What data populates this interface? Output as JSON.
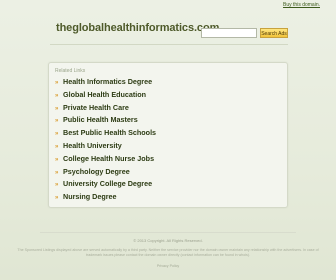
{
  "header": {
    "buy_link": "Buy this domain.",
    "domain": "theglobalhealthinformatics.com",
    "search_placeholder": "",
    "search_button": "Search Ads"
  },
  "panel": {
    "label": "Related Links",
    "links": [
      "Health Informatics Degree",
      "Global Health Education",
      "Private Health Care",
      "Public Health Masters",
      "Best Public Health Schools",
      "Health University",
      "College Health Nurse Jobs",
      "Psychology Degree",
      "University College Degree",
      "Nursing Degree"
    ]
  },
  "footer": {
    "copyright": "© 2013 Copyright. All Rights Reserved.",
    "disclaimer": "The Sponsored Listings displayed above are served automatically by a third party. Neither the service provider nor the domain owner maintain any relationship with the advertisers. In case of trademark issues please contact the domain owner directly (contact information can be found in whois).",
    "privacy": "Privacy Policy"
  },
  "colors": {
    "background": "#e3e9d7",
    "link_text": "#2d3c14",
    "arrow": "#d99a2a",
    "search_button": "#f2c43a"
  }
}
